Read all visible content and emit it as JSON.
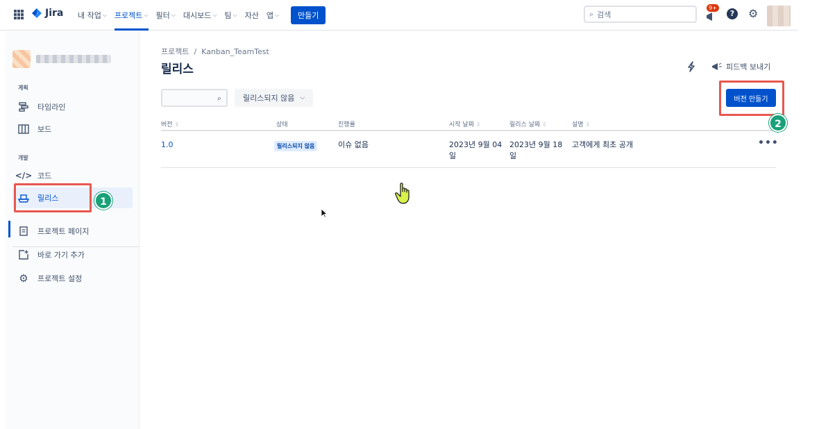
{
  "topnav": {
    "logo_text": "Jira",
    "items": [
      {
        "label": "내 작업",
        "chevron": true
      },
      {
        "label": "프로젝트",
        "chevron": true,
        "active": true
      },
      {
        "label": "필터",
        "chevron": true
      },
      {
        "label": "대시보드",
        "chevron": true
      },
      {
        "label": "팀",
        "chevron": true
      },
      {
        "label": "자산",
        "chevron": false
      },
      {
        "label": "앱",
        "chevron": true
      }
    ],
    "create_label": "만들기",
    "search_placeholder": "검색",
    "notification_badge": "9+",
    "help_glyph": "?"
  },
  "sidebar": {
    "section_plan": "계획",
    "section_dev": "개발",
    "items": [
      {
        "label": "타임라인",
        "icon": "timeline-icon"
      },
      {
        "label": "보드",
        "icon": "board-icon"
      },
      {
        "label": "코드",
        "icon": "code-icon"
      },
      {
        "label": "릴리스",
        "icon": "release-icon",
        "selected": true
      },
      {
        "label": "프로젝트 페이지",
        "icon": "page-icon"
      },
      {
        "label": "바로 가기 추가",
        "icon": "add-shortcut-icon"
      },
      {
        "label": "프로젝트 설정",
        "icon": "settings-icon"
      }
    ]
  },
  "main": {
    "breadcrumb": "프로젝트  /  Kanban_TeamTest",
    "title": "릴리스",
    "feedback_label": "피드백 보내기",
    "filter_dropdown": "릴리스되지 않음",
    "create_version_label": "버전 만들기",
    "columns": [
      "버전",
      "상태",
      "진행률",
      "시작 날짜",
      "릴리스 날짜",
      "설명"
    ],
    "rows": [
      {
        "version": "1.0",
        "status": "릴리스되지 않음",
        "progress": "이슈 없음",
        "start_date": "2023년 9월 04 일",
        "release_date": "2023년 9월 18 일",
        "description": "고객에게 최초 공개",
        "more": "•••"
      }
    ]
  },
  "annotations": {
    "step1": "1",
    "step2": "2"
  },
  "colors": {
    "brand": "#0052cc",
    "highlight": "#e8574e",
    "step_badge": "#1aa179"
  }
}
